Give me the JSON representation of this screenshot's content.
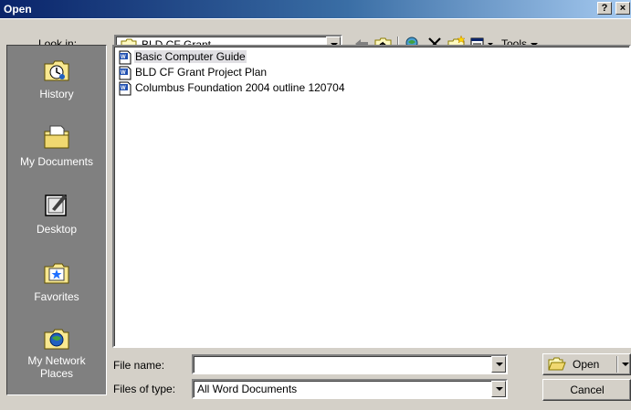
{
  "window": {
    "title": "Open",
    "help_label": "?",
    "close_label": "×"
  },
  "lookin": {
    "label": "Look in:",
    "value": "BLD CF Grant"
  },
  "toolbar": {
    "tools_label": "Tools"
  },
  "places": [
    {
      "label": "History",
      "icon": "history-icon"
    },
    {
      "label": "My Documents",
      "icon": "my-documents-icon"
    },
    {
      "label": "Desktop",
      "icon": "desktop-icon"
    },
    {
      "label": "Favorites",
      "icon": "favorites-icon"
    },
    {
      "label_line1": "My Network",
      "label_line2": "Places",
      "icon": "network-icon"
    }
  ],
  "files": [
    {
      "name": "Basic Computer Guide",
      "selected": true
    },
    {
      "name": "BLD CF Grant Project Plan",
      "selected": false
    },
    {
      "name": "Columbus Foundation 2004 outline 120704",
      "selected": false
    }
  ],
  "filename": {
    "label": "File name:",
    "value": ""
  },
  "filetype": {
    "label": "Files of type:",
    "value": "All Word Documents"
  },
  "buttons": {
    "open": "Open",
    "cancel": "Cancel"
  },
  "colors": {
    "title_start": "#0a246a",
    "title_end": "#a6caf0",
    "face": "#d4d0c8",
    "places_bg": "#808080"
  }
}
